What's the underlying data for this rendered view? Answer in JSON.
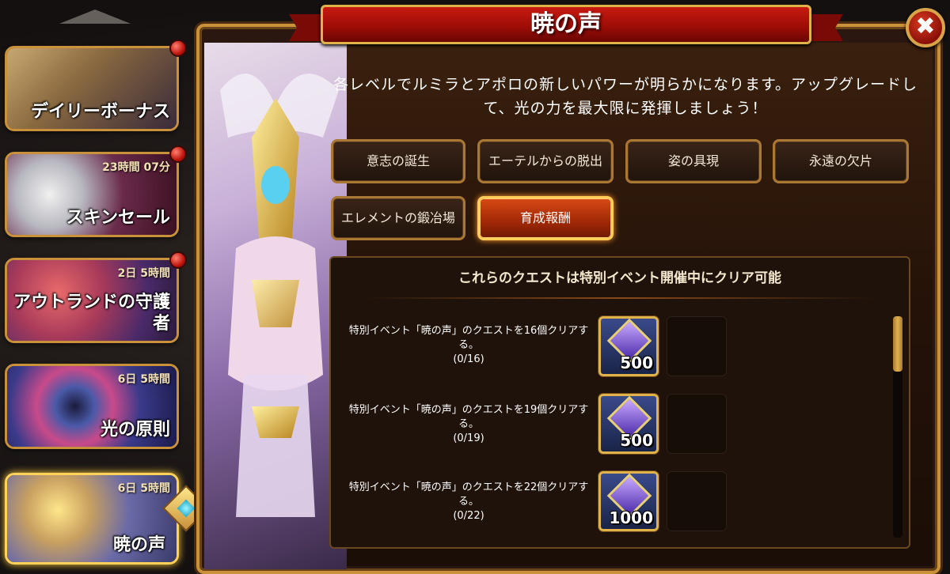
{
  "title": "暁の声",
  "description": "各レベルでルミラとアポロの新しいパワーが明らかになります。アップグレードして、光の力を最大限に発揮しましょう！",
  "close_icon": "close-icon",
  "colors": {
    "accent_gold": "#c8913a",
    "active_tab": "#d84a14",
    "title_red": "#c81a10"
  },
  "sidebar": {
    "items": [
      {
        "label": "デイリーボーナス",
        "timer": "",
        "has_badge": true
      },
      {
        "label": "スキンセール",
        "timer": "23時間 07分",
        "has_badge": true
      },
      {
        "label": "アウトランドの守護者",
        "timer": "2日 5時間",
        "has_badge": true
      },
      {
        "label": "光の原則",
        "timer": "6日 5時間",
        "has_badge": false
      },
      {
        "label": "暁の声",
        "timer": "6日 5時間",
        "has_badge": false,
        "selected": true
      }
    ]
  },
  "tabs": [
    {
      "label": "意志の誕生",
      "active": false
    },
    {
      "label": "エーテルからの脱出",
      "active": false
    },
    {
      "label": "姿の具現",
      "active": false
    },
    {
      "label": "永遠の欠片",
      "active": false
    },
    {
      "label": "エレメントの鍛冶場",
      "active": false
    },
    {
      "label": "育成報酬",
      "active": true
    }
  ],
  "quests": {
    "header": "これらのクエストは特別イベント開催中にクリア可能",
    "items": [
      {
        "text": "特別イベント「暁の声」のクエストを16個クリアする。",
        "progress": "(0/16)",
        "reward_amount": "500"
      },
      {
        "text": "特別イベント「暁の声」のクエストを19個クリアする。",
        "progress": "(0/19)",
        "reward_amount": "500"
      },
      {
        "text": "特別イベント「暁の声」のクエストを22個クリアする。",
        "progress": "(0/22)",
        "reward_amount": "1000"
      }
    ]
  }
}
